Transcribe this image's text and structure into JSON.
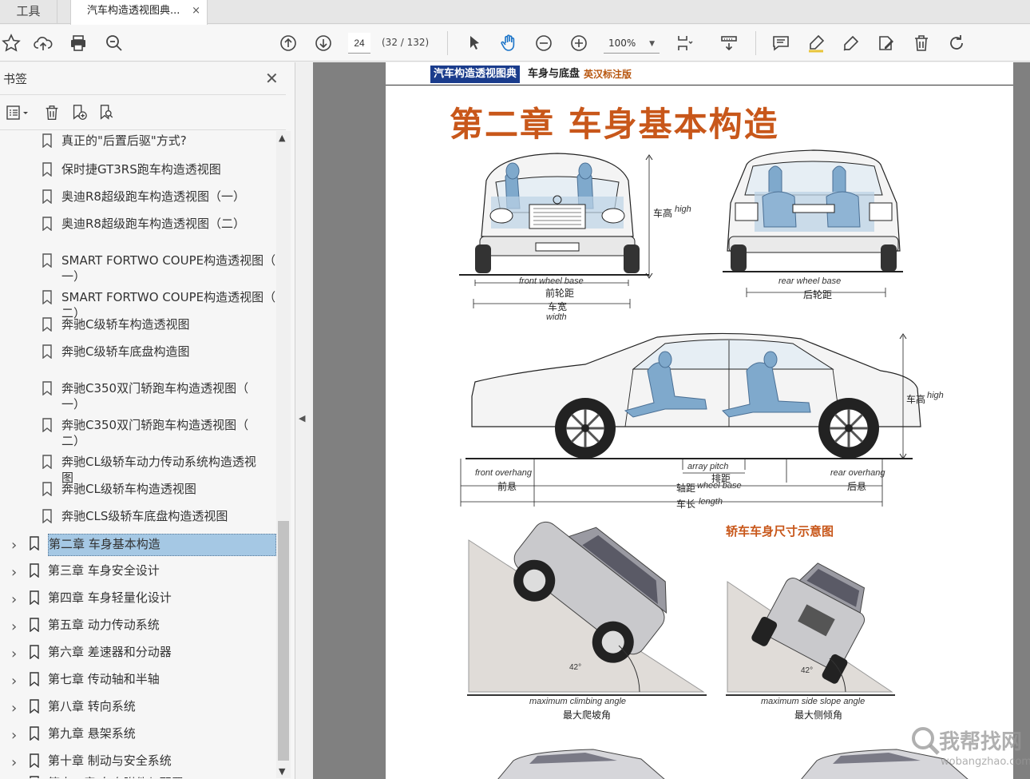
{
  "tabs": {
    "tools_label": "工具",
    "document_label": "汽车构造透视图典...",
    "close_glyph": "×"
  },
  "toolbar": {
    "page_number": "24",
    "page_count": "(32 / 132)",
    "zoom": "100%"
  },
  "sidebar": {
    "title": "书签",
    "items": [
      {
        "label": "真正的\"后置后驱\"方式?",
        "indent": 2
      },
      {
        "label": "保时捷GT3RS跑车构造透视图",
        "indent": 2
      },
      {
        "label": "奥迪R8超级跑车构造透视图（一）",
        "indent": 2
      },
      {
        "label": "奥迪R8超级跑车构造透视图（二）",
        "indent": 2
      },
      {
        "label": "SMART FORTWO COUPE构造透视图（",
        "label2": "一）",
        "indent": 2
      },
      {
        "label": "SMART FORTWO COUPE构造透视图（",
        "label2": "二）",
        "indent": 2
      },
      {
        "label": "奔驰C级轿车构造透视图",
        "indent": 2
      },
      {
        "label": "奔驰C级轿车底盘构造图",
        "indent": 2
      },
      {
        "label": "奔驰C350双门轿跑车构造透视图（",
        "label2": "一）",
        "indent": 2
      },
      {
        "label": "奔驰C350双门轿跑车构造透视图（",
        "label2": "二）",
        "indent": 2
      },
      {
        "label": "奔驰CL级轿车动力传动系统构造透视",
        "label2": "图",
        "indent": 2
      },
      {
        "label": "奔驰CL级轿车构造透视图",
        "indent": 2
      },
      {
        "label": "奔驰CLS级轿车底盘构造透视图",
        "indent": 2
      },
      {
        "label": "第二章  车身基本构造",
        "indent": 1,
        "selected": true
      },
      {
        "label": "第三章  车身安全设计",
        "indent": 1
      },
      {
        "label": "第四章  车身轻量化设计",
        "indent": 1
      },
      {
        "label": "第五章  动力传动系统",
        "indent": 1
      },
      {
        "label": "第六章  差速器和分动器",
        "indent": 1
      },
      {
        "label": "第七章  传动轴和半轴",
        "indent": 1
      },
      {
        "label": "第八章  转向系统",
        "indent": 1
      },
      {
        "label": "第九章  悬架系统",
        "indent": 1
      },
      {
        "label": "第十章  制动与安全系统",
        "indent": 1
      },
      {
        "label": "第十一章  车身附件与配置",
        "indent": 1
      }
    ]
  },
  "page": {
    "header_book": "汽车构造透视图典",
    "header_section": "车身与底盘",
    "header_tag": "英汉标注版",
    "chapter_title": "第二章  车身基本构造",
    "front_view": {
      "height_cn": "车高",
      "height_en": "high",
      "track_en": "front wheel base",
      "track_cn": "前轮距",
      "width_cn": "车宽",
      "width_en": "width"
    },
    "rear_view": {
      "track_en": "rear wheel base",
      "track_cn": "后轮距"
    },
    "side_view": {
      "height_cn": "车高",
      "height_en": "high",
      "front_overhang_en": "front overhang",
      "front_overhang_cn": "前悬",
      "array_pitch_en": "array pitch",
      "array_pitch_cn": "排距",
      "wheelbase_cn": "轴距",
      "wheelbase_en": "wheel base",
      "rear_overhang_en": "rear overhang",
      "rear_overhang_cn": "后悬",
      "length_cn": "车长",
      "length_en": "length"
    },
    "caption": "轿车车身尺寸示意图",
    "climb": {
      "angle": "42°",
      "label_en": "maximum climbing angle",
      "label_cn": "最大爬坡角"
    },
    "side_slope": {
      "angle": "42°",
      "label_en": "maximum side slope angle",
      "label_cn": "最大侧倾角"
    }
  },
  "watermark": {
    "text": "我帮找网",
    "url": "wobangzhao.com"
  }
}
